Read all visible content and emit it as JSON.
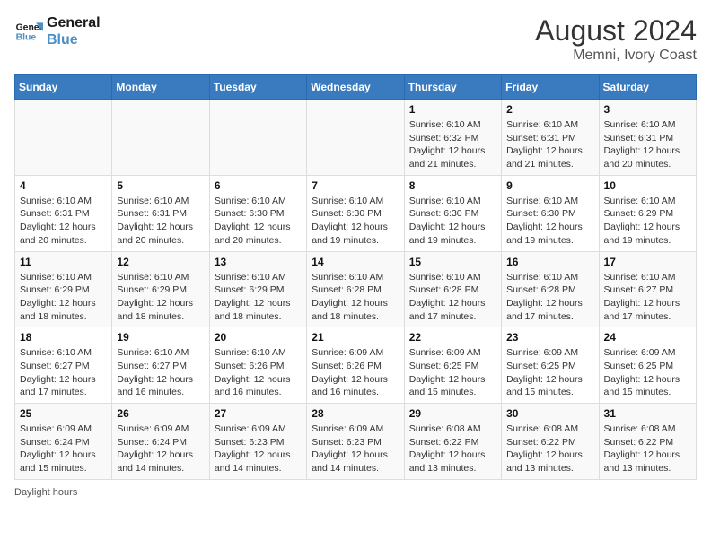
{
  "header": {
    "logo_line1": "General",
    "logo_line2": "Blue",
    "month_year": "August 2024",
    "location": "Memni, Ivory Coast"
  },
  "days_of_week": [
    "Sunday",
    "Monday",
    "Tuesday",
    "Wednesday",
    "Thursday",
    "Friday",
    "Saturday"
  ],
  "footer": {
    "note": "Daylight hours"
  },
  "weeks": [
    [
      {
        "num": "",
        "info": ""
      },
      {
        "num": "",
        "info": ""
      },
      {
        "num": "",
        "info": ""
      },
      {
        "num": "",
        "info": ""
      },
      {
        "num": "1",
        "info": "Sunrise: 6:10 AM\nSunset: 6:32 PM\nDaylight: 12 hours\nand 21 minutes."
      },
      {
        "num": "2",
        "info": "Sunrise: 6:10 AM\nSunset: 6:31 PM\nDaylight: 12 hours\nand 21 minutes."
      },
      {
        "num": "3",
        "info": "Sunrise: 6:10 AM\nSunset: 6:31 PM\nDaylight: 12 hours\nand 20 minutes."
      }
    ],
    [
      {
        "num": "4",
        "info": "Sunrise: 6:10 AM\nSunset: 6:31 PM\nDaylight: 12 hours\nand 20 minutes."
      },
      {
        "num": "5",
        "info": "Sunrise: 6:10 AM\nSunset: 6:31 PM\nDaylight: 12 hours\nand 20 minutes."
      },
      {
        "num": "6",
        "info": "Sunrise: 6:10 AM\nSunset: 6:30 PM\nDaylight: 12 hours\nand 20 minutes."
      },
      {
        "num": "7",
        "info": "Sunrise: 6:10 AM\nSunset: 6:30 PM\nDaylight: 12 hours\nand 19 minutes."
      },
      {
        "num": "8",
        "info": "Sunrise: 6:10 AM\nSunset: 6:30 PM\nDaylight: 12 hours\nand 19 minutes."
      },
      {
        "num": "9",
        "info": "Sunrise: 6:10 AM\nSunset: 6:30 PM\nDaylight: 12 hours\nand 19 minutes."
      },
      {
        "num": "10",
        "info": "Sunrise: 6:10 AM\nSunset: 6:29 PM\nDaylight: 12 hours\nand 19 minutes."
      }
    ],
    [
      {
        "num": "11",
        "info": "Sunrise: 6:10 AM\nSunset: 6:29 PM\nDaylight: 12 hours\nand 18 minutes."
      },
      {
        "num": "12",
        "info": "Sunrise: 6:10 AM\nSunset: 6:29 PM\nDaylight: 12 hours\nand 18 minutes."
      },
      {
        "num": "13",
        "info": "Sunrise: 6:10 AM\nSunset: 6:29 PM\nDaylight: 12 hours\nand 18 minutes."
      },
      {
        "num": "14",
        "info": "Sunrise: 6:10 AM\nSunset: 6:28 PM\nDaylight: 12 hours\nand 18 minutes."
      },
      {
        "num": "15",
        "info": "Sunrise: 6:10 AM\nSunset: 6:28 PM\nDaylight: 12 hours\nand 17 minutes."
      },
      {
        "num": "16",
        "info": "Sunrise: 6:10 AM\nSunset: 6:28 PM\nDaylight: 12 hours\nand 17 minutes."
      },
      {
        "num": "17",
        "info": "Sunrise: 6:10 AM\nSunset: 6:27 PM\nDaylight: 12 hours\nand 17 minutes."
      }
    ],
    [
      {
        "num": "18",
        "info": "Sunrise: 6:10 AM\nSunset: 6:27 PM\nDaylight: 12 hours\nand 17 minutes."
      },
      {
        "num": "19",
        "info": "Sunrise: 6:10 AM\nSunset: 6:27 PM\nDaylight: 12 hours\nand 16 minutes."
      },
      {
        "num": "20",
        "info": "Sunrise: 6:10 AM\nSunset: 6:26 PM\nDaylight: 12 hours\nand 16 minutes."
      },
      {
        "num": "21",
        "info": "Sunrise: 6:09 AM\nSunset: 6:26 PM\nDaylight: 12 hours\nand 16 minutes."
      },
      {
        "num": "22",
        "info": "Sunrise: 6:09 AM\nSunset: 6:25 PM\nDaylight: 12 hours\nand 15 minutes."
      },
      {
        "num": "23",
        "info": "Sunrise: 6:09 AM\nSunset: 6:25 PM\nDaylight: 12 hours\nand 15 minutes."
      },
      {
        "num": "24",
        "info": "Sunrise: 6:09 AM\nSunset: 6:25 PM\nDaylight: 12 hours\nand 15 minutes."
      }
    ],
    [
      {
        "num": "25",
        "info": "Sunrise: 6:09 AM\nSunset: 6:24 PM\nDaylight: 12 hours\nand 15 minutes."
      },
      {
        "num": "26",
        "info": "Sunrise: 6:09 AM\nSunset: 6:24 PM\nDaylight: 12 hours\nand 14 minutes."
      },
      {
        "num": "27",
        "info": "Sunrise: 6:09 AM\nSunset: 6:23 PM\nDaylight: 12 hours\nand 14 minutes."
      },
      {
        "num": "28",
        "info": "Sunrise: 6:09 AM\nSunset: 6:23 PM\nDaylight: 12 hours\nand 14 minutes."
      },
      {
        "num": "29",
        "info": "Sunrise: 6:08 AM\nSunset: 6:22 PM\nDaylight: 12 hours\nand 13 minutes."
      },
      {
        "num": "30",
        "info": "Sunrise: 6:08 AM\nSunset: 6:22 PM\nDaylight: 12 hours\nand 13 minutes."
      },
      {
        "num": "31",
        "info": "Sunrise: 6:08 AM\nSunset: 6:22 PM\nDaylight: 12 hours\nand 13 minutes."
      }
    ]
  ]
}
